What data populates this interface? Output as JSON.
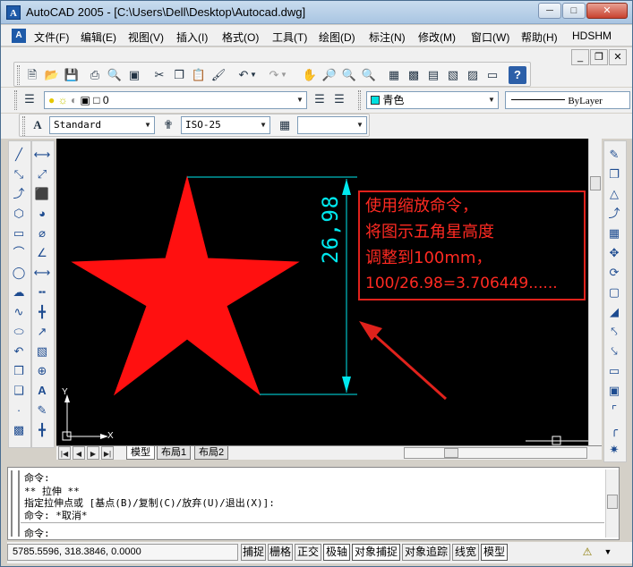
{
  "window": {
    "title": "AutoCAD 2005 - [C:\\Users\\Dell\\Desktop\\Autocad.dwg]",
    "app_icon": "A",
    "buttons": [
      "minimize",
      "maximize",
      "close"
    ]
  },
  "menu": {
    "items": [
      "文件(F)",
      "编辑(E)",
      "视图(V)",
      "插入(I)",
      "格式(O)",
      "工具(T)",
      "绘图(D)",
      "标注(N)",
      "修改(M)",
      "窗口(W)",
      "帮助(H)",
      "HDSHM"
    ]
  },
  "layers": {
    "current_layer": "0",
    "color": "青色",
    "linetype": "ByLayer"
  },
  "styles": {
    "text_style": "Standard",
    "dim_style": "ISO-25",
    "table_style": ""
  },
  "drawing": {
    "dimension_value": "26,98",
    "ucs_y": "Y",
    "ucs_x": "X",
    "colors": {
      "star": "#ff1010",
      "dimension": "#00e8ee",
      "annotation": "#ff2a22",
      "arrow": "#e0221c"
    }
  },
  "annotation": {
    "lines": [
      "使用缩放命令，",
      "将图示五角星高度",
      "调整到100mm，",
      "100/26.98=3.706449......"
    ]
  },
  "layout_tabs": [
    "模型",
    "布局1",
    "布局2"
  ],
  "command": {
    "lines": [
      "命令:",
      "** 拉伸 **",
      "指定拉伸点或 [基点(B)/复制(C)/放弃(U)/退出(X)]:",
      "命令: *取消*"
    ],
    "prompt": "命令:"
  },
  "status": {
    "coordinates": "5785.5596, 318.3846, 0.0000",
    "toggles": [
      "捕捉",
      "栅格",
      "正交",
      "极轴",
      "对象捕捉",
      "对象追踪",
      "线宽",
      "模型"
    ],
    "on_toggles": [
      "极轴",
      "对象捕捉",
      "模型"
    ]
  }
}
